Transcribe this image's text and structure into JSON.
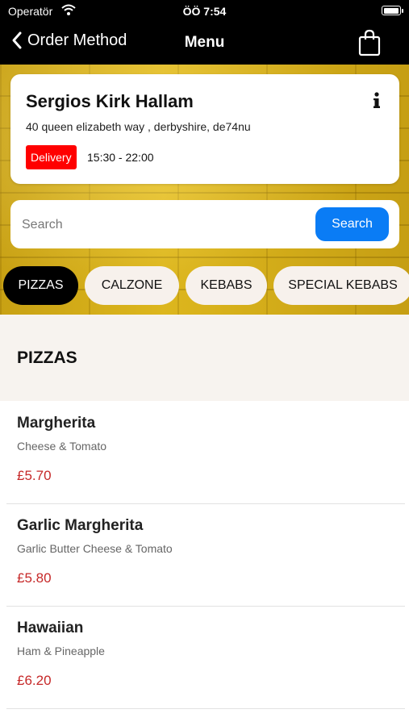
{
  "status_bar": {
    "carrier": "Operatör",
    "time": "ÖÖ 7:54"
  },
  "nav": {
    "back_label": "Order Method",
    "title": "Menu"
  },
  "restaurant": {
    "name": "Sergios Kirk Hallam",
    "address": "40 queen elizabeth way , derbyshire, de74nu",
    "service_badge": "Delivery",
    "hours": "15:30 - 22:00"
  },
  "search": {
    "placeholder": "Search",
    "button_label": "Search"
  },
  "categories": [
    "PIZZAS",
    "CALZONE",
    "KEBABS",
    "SPECIAL KEBABS"
  ],
  "section_title": "PIZZAS",
  "items": [
    {
      "name": "Margherita",
      "description": "Cheese & Tomato",
      "price": "£5.70"
    },
    {
      "name": "Garlic Margherita",
      "description": "Garlic Butter Cheese & Tomato",
      "price": "£5.80"
    },
    {
      "name": "Hawaiian",
      "description": "Ham & Pineapple",
      "price": "£6.20"
    }
  ],
  "colors": {
    "accent": "#0a7cf5",
    "badge": "#ff0000",
    "price": "#c62828",
    "nav": "#000000"
  }
}
